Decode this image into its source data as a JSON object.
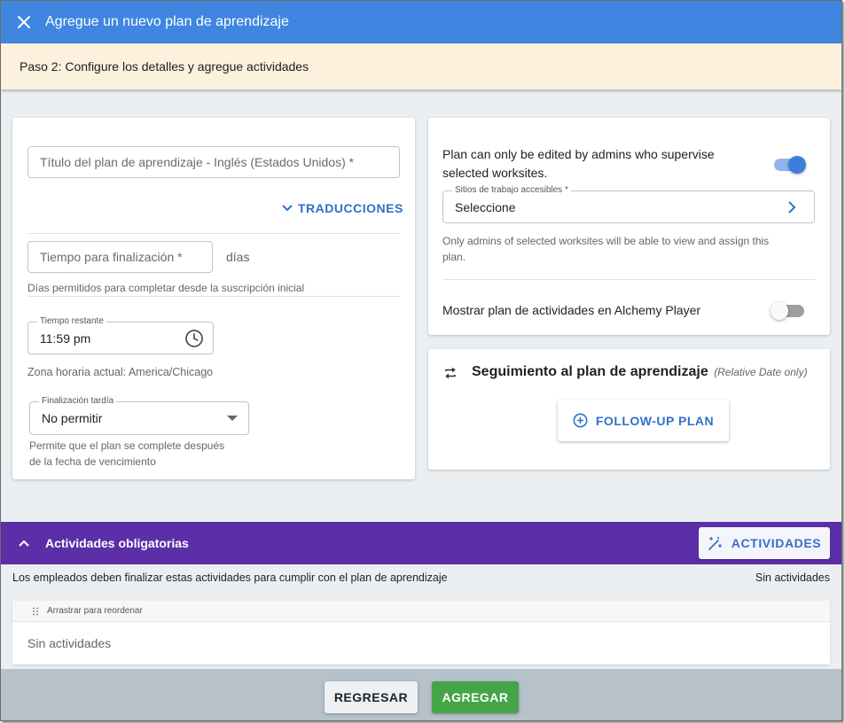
{
  "dialog": {
    "title": "Agregue un nuevo plan de aprendizaje"
  },
  "step": {
    "text": "Paso 2: Configure los detalles y agregue actividades"
  },
  "details": {
    "title_placeholder": "Título del plan de aprendizaje - Inglés (Estados Unidos) *",
    "translations_label": "TRADUCCIONES",
    "completion_time_placeholder": "Tiempo para finalización *",
    "completion_time_unit": "días",
    "completion_time_help": "Días permitidos para completar desde la suscripción inicial",
    "remaining_time_label": "Tiempo restante",
    "remaining_time_value": "11:59 pm",
    "timezone_text": "Zona horaria actual: America/Chicago",
    "late_completion_label": "Finalización tardía",
    "late_completion_value": "No permitir",
    "late_completion_help_1": "Permite que el plan se complete después",
    "late_completion_help_2": "de la fecha de vencimiento"
  },
  "access": {
    "admin_edit_text_1": "Plan can only be edited by admins who supervise",
    "admin_edit_text_2": "selected worksites.",
    "admin_edit_toggle_on": true,
    "worksites_label": "Sitios de trabajo accesibles *",
    "worksites_value": "Seleccione",
    "worksites_help_1": "Only admins of selected worksites will be able to view and assign this",
    "worksites_help_2": "plan.",
    "alchemy_player_text": "Mostrar plan de actividades en Alchemy Player",
    "alchemy_player_toggle_on": false
  },
  "followup": {
    "title": "Seguimiento al plan de aprendizaje",
    "note": "(Relative Date only)",
    "button_label": "FOLLOW-UP PLAN"
  },
  "required": {
    "title": "Actividades obligatorias",
    "activities_button": "ACTIVIDADES",
    "description": "Los empleados deben finalizar estas actividades para cumplir con el plan de aprendizaje",
    "count_text": "Sin actividades",
    "table_header": "Arrastrar para reordenar",
    "empty_text": "Sin actividades"
  },
  "footer": {
    "back_label": "REGRESAR",
    "add_label": "AGREGAR"
  },
  "colors": {
    "header_blue": "#3f86e0",
    "step_bg": "#fcf1dd",
    "purple": "#5c2ea7",
    "accent_blue": "#2f71c9",
    "toggle_on": "#3f7ddb",
    "add_green": "#43a547"
  }
}
